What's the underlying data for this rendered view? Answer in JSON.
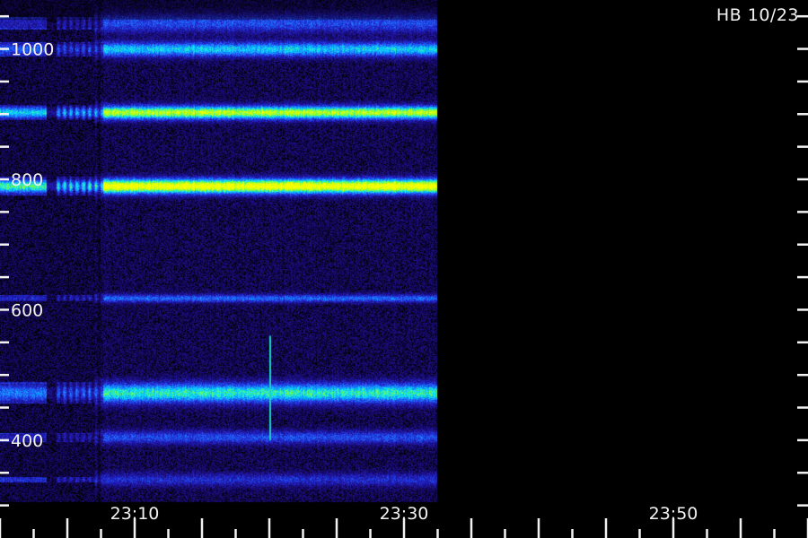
{
  "header": {
    "title": "HB 10/23"
  },
  "chart_data": {
    "type": "heatmap",
    "title": "HB 10/23",
    "xlabel": "",
    "ylabel": "",
    "x_range": [
      "23:00",
      "24:00"
    ],
    "x_tick_labels": [
      "23:10",
      "23:30",
      "23:50"
    ],
    "x_minor_tick_step_minutes": 2.5,
    "y_range": [
      250,
      1075
    ],
    "y_tick_labels": [
      "1000",
      "800",
      "600",
      "400"
    ],
    "y_tick_step": 100,
    "data_extent": [
      "23:00",
      "23:32:30"
    ],
    "colormap": [
      "#000010",
      "#1a0a6e",
      "#2222cc",
      "#1f70ff",
      "#00e0ff",
      "#7dff3c",
      "#f5ff00"
    ],
    "bands": [
      {
        "freq": 1040,
        "width": 14,
        "level": 0.3
      },
      {
        "freq": 1000,
        "width": 11,
        "level": 0.52
      },
      {
        "freq": 903,
        "width": 10,
        "level": 0.8
      },
      {
        "freq": 790,
        "width": 11,
        "level": 0.96
      },
      {
        "freq": 618,
        "width": 6,
        "level": 0.35
      },
      {
        "freq": 473,
        "width": 15,
        "level": 0.6
      },
      {
        "freq": 405,
        "width": 10,
        "level": 0.3
      },
      {
        "freq": 340,
        "width": 10,
        "level": 0.22
      }
    ],
    "annotations": [
      {
        "type": "vertical_streak",
        "time": "23:20",
        "freq_range": [
          400,
          560
        ]
      }
    ]
  }
}
